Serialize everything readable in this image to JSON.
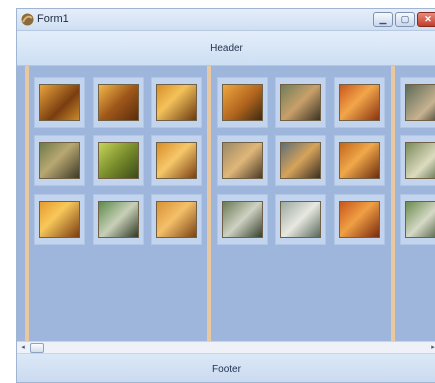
{
  "window": {
    "title": "Form1",
    "icon": "app-icon",
    "controls": {
      "minimize": "minimize-icon",
      "maximize": "maximize-icon",
      "close": "close-icon"
    }
  },
  "header": {
    "label": "Header"
  },
  "footer": {
    "label": "Footer"
  },
  "scrollbar": {
    "orientation": "horizontal",
    "left_icon": "scroll-left-arrow-icon",
    "right_icon": "scroll-right-arrow-icon"
  },
  "gallery": {
    "thumbnails": [
      {
        "name": "thumb-1"
      },
      {
        "name": "thumb-2"
      },
      {
        "name": "thumb-3"
      },
      {
        "name": "thumb-4"
      },
      {
        "name": "thumb-5"
      },
      {
        "name": "thumb-6"
      },
      {
        "name": "thumb-7"
      },
      {
        "name": "thumb-8"
      },
      {
        "name": "thumb-9"
      },
      {
        "name": "thumb-10"
      },
      {
        "name": "thumb-11"
      },
      {
        "name": "thumb-12"
      },
      {
        "name": "thumb-13"
      },
      {
        "name": "thumb-14"
      },
      {
        "name": "thumb-15"
      },
      {
        "name": "thumb-16"
      },
      {
        "name": "thumb-17"
      },
      {
        "name": "thumb-18"
      },
      {
        "name": "thumb-19"
      },
      {
        "name": "thumb-20"
      },
      {
        "name": "thumb-21"
      }
    ]
  },
  "colors": {
    "content_bg": "#9eb6dc",
    "divider": "#e9c79f",
    "panel": "#d4e3f5"
  }
}
